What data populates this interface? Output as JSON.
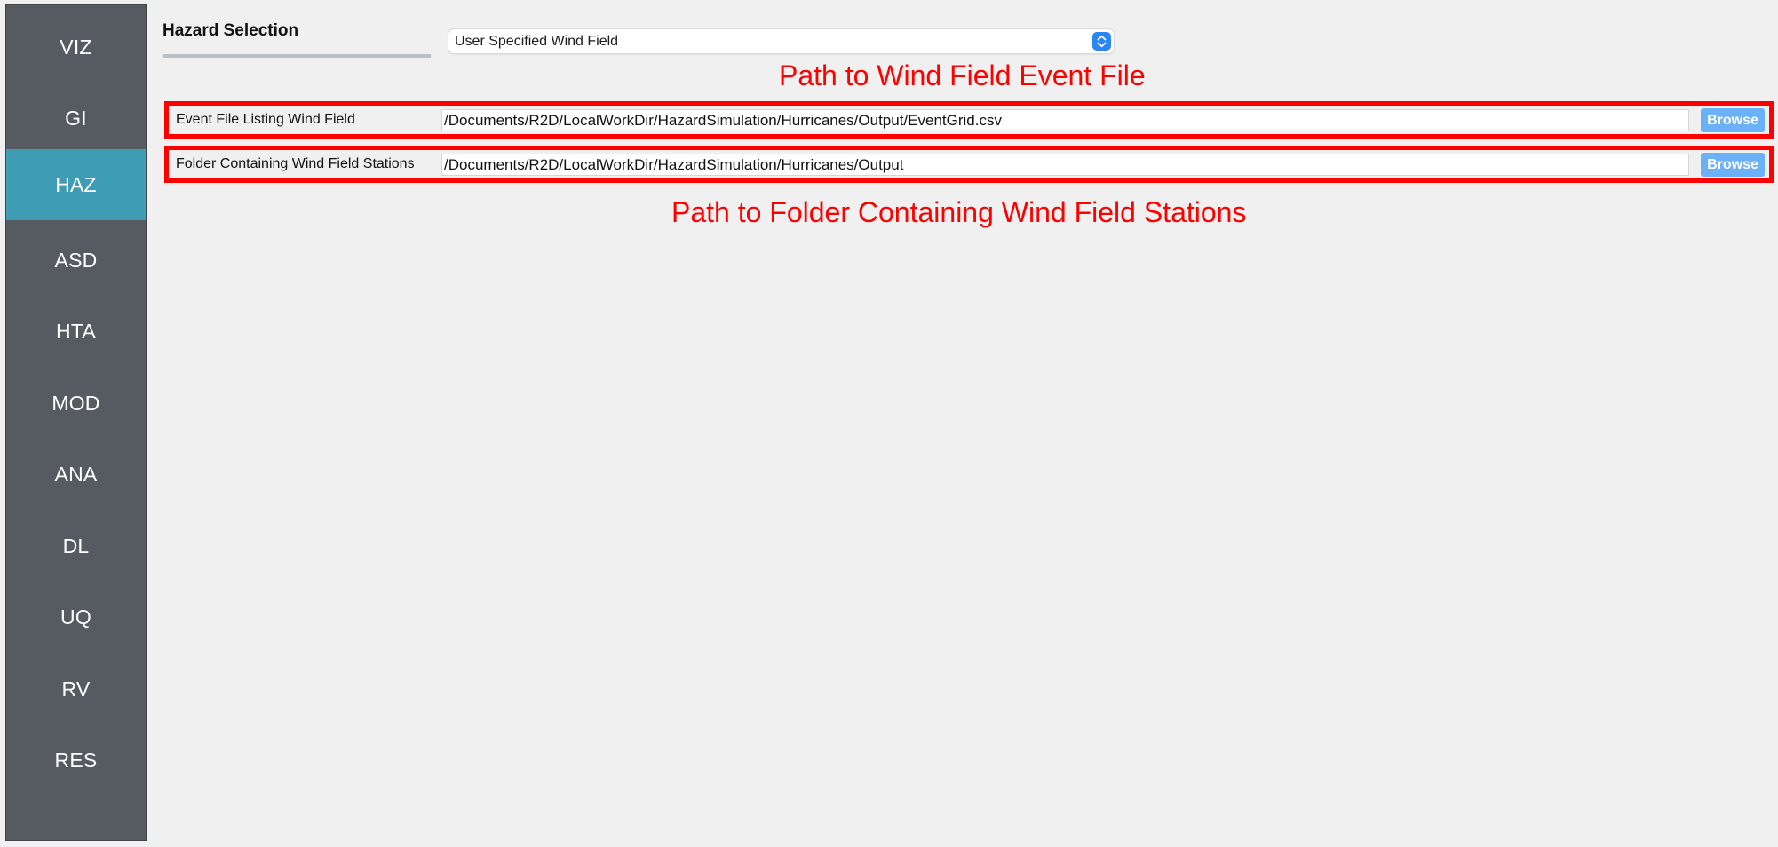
{
  "sidebar": {
    "items": [
      {
        "label": "VIZ",
        "active": false
      },
      {
        "label": "GI",
        "active": false
      },
      {
        "label": "HAZ",
        "active": true
      },
      {
        "label": "ASD",
        "active": false
      },
      {
        "label": "HTA",
        "active": false
      },
      {
        "label": "MOD",
        "active": false
      },
      {
        "label": "ANA",
        "active": false
      },
      {
        "label": "DL",
        "active": false
      },
      {
        "label": "UQ",
        "active": false
      },
      {
        "label": "RV",
        "active": false
      },
      {
        "label": "RES",
        "active": false
      }
    ],
    "active_color": "#3e9db5",
    "background_color": "#565b61"
  },
  "hazard": {
    "label": "Hazard Selection",
    "selected": "User Specified Wind Field",
    "select_icon": "up-down-chevron-icon"
  },
  "fields": [
    {
      "label": "Event File Listing Wind Field",
      "value": "/Documents/R2D/LocalWorkDir/HazardSimulation/Hurricanes/Output/EventGrid.csv",
      "button": "Browse"
    },
    {
      "label": "Folder Containing Wind Field Stations",
      "value": "/Documents/R2D/LocalWorkDir/HazardSimulation/Hurricanes/Output",
      "button": "Browse"
    }
  ],
  "annotations": {
    "event_file": "Path to Wind Field Event File",
    "stations_folder": "Path to Folder Containing Wind Field Stations",
    "color": "#ff0000"
  }
}
